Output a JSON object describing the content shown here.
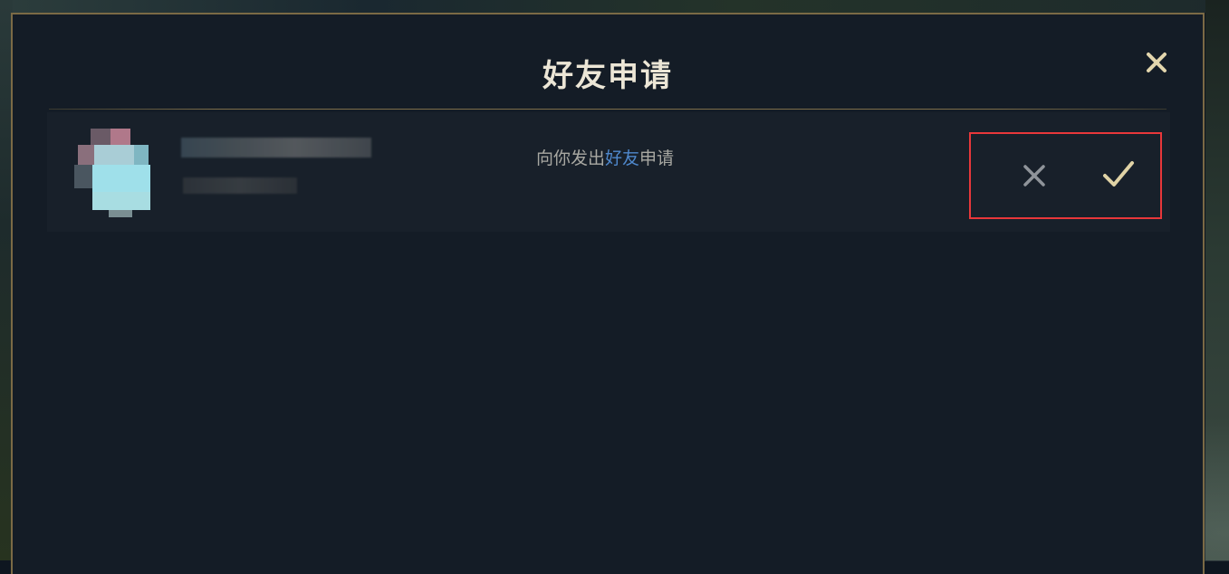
{
  "dialog": {
    "title": "好友申请",
    "close_icon": "close-icon"
  },
  "request": {
    "message_prefix": "向你发出",
    "message_highlight": "好友",
    "message_suffix": "申请",
    "decline_icon": "x-icon",
    "accept_icon": "checkmark-icon"
  },
  "colors": {
    "accent_gold": "#c9b37a",
    "highlight_link": "#4f88cc",
    "annotation_box": "#e8373a"
  }
}
